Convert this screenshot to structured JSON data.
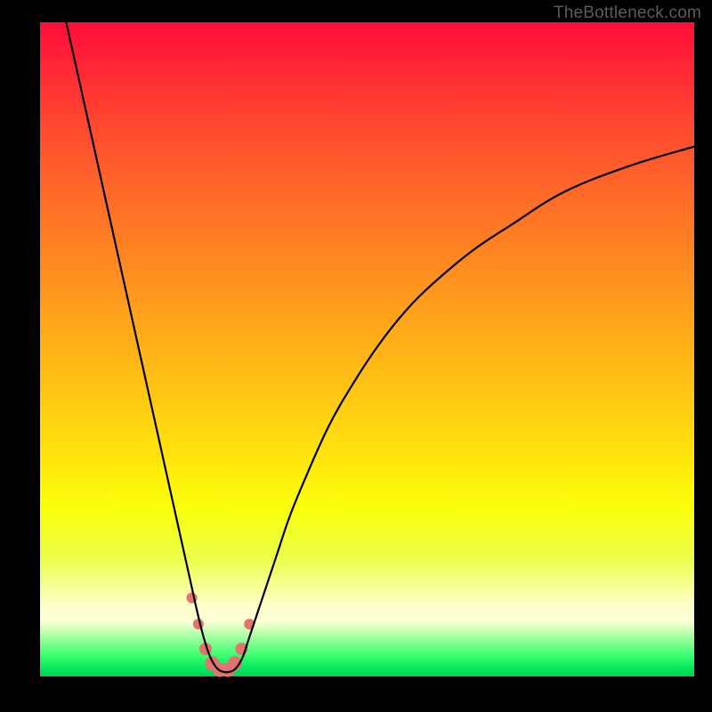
{
  "watermark": "TheBottleneck.com",
  "chart_data": {
    "type": "line",
    "title": "",
    "xlabel": "",
    "ylabel": "",
    "xlim": [
      0,
      100
    ],
    "ylim": [
      0,
      100
    ],
    "series": [
      {
        "name": "bottleneck-curve",
        "x": [
          4,
          6,
          8,
          10,
          12,
          14,
          16,
          18,
          20,
          22,
          23,
          24,
          25,
          26,
          27,
          28,
          29,
          30,
          31,
          32,
          34,
          36,
          38,
          40,
          44,
          48,
          52,
          56,
          60,
          66,
          72,
          80,
          90,
          100
        ],
        "y": [
          100,
          91,
          82,
          73,
          64,
          55,
          46,
          37,
          28,
          19,
          14.5,
          10,
          6,
          3,
          1.3,
          0.7,
          0.7,
          1.3,
          3,
          6,
          12,
          18,
          24,
          29,
          38,
          45,
          51,
          56,
          60,
          65,
          69,
          74,
          78,
          81
        ]
      }
    ],
    "markers": {
      "name": "highlight-points",
      "color": "#e2736f",
      "points": [
        {
          "x": 23.2,
          "y": 12.0,
          "r": 6
        },
        {
          "x": 24.2,
          "y": 8.0,
          "r": 6
        },
        {
          "x": 25.3,
          "y": 4.2,
          "r": 7
        },
        {
          "x": 26.3,
          "y": 2.0,
          "r": 8
        },
        {
          "x": 27.5,
          "y": 1.0,
          "r": 8
        },
        {
          "x": 28.7,
          "y": 1.0,
          "r": 8
        },
        {
          "x": 29.8,
          "y": 2.0,
          "r": 8
        },
        {
          "x": 30.8,
          "y": 4.2,
          "r": 7
        },
        {
          "x": 32.0,
          "y": 8.0,
          "r": 6
        }
      ]
    },
    "background_gradient": {
      "top": "#ff0d3a",
      "mid": "#ffe30d",
      "bottom": "#00d052"
    }
  }
}
